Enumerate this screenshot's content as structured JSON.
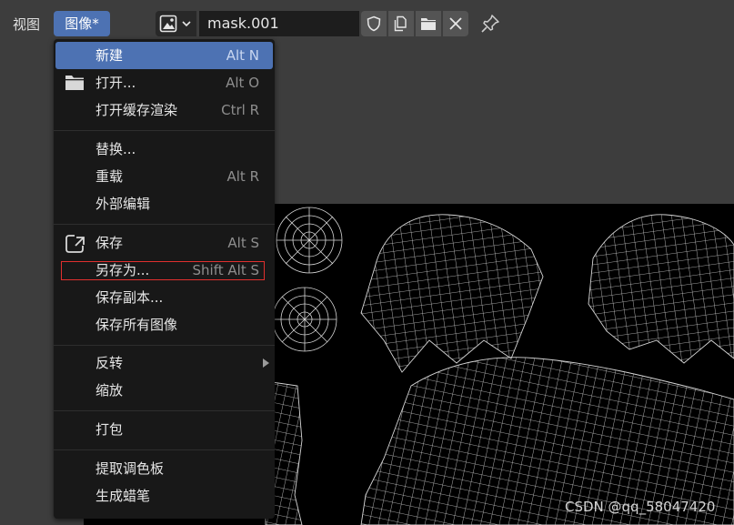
{
  "header": {
    "view_menu": "视图",
    "image_menu": "图像*",
    "image_name": "mask.001",
    "icons": [
      "image-type-icon",
      "shield-icon",
      "duplicate-icon",
      "folder-icon",
      "close-icon",
      "pin-icon"
    ]
  },
  "image_menu": {
    "items": [
      {
        "label": "新建",
        "shortcut": "Alt N",
        "icon": null,
        "active": true
      },
      {
        "label": "打开...",
        "shortcut": "Alt O",
        "icon": "folder-icon"
      },
      {
        "label": "打开缓存渲染",
        "shortcut": "Ctrl R"
      },
      {
        "label": "替换...",
        "shortcut": ""
      },
      {
        "label": "重载",
        "shortcut": "Alt R"
      },
      {
        "label": "外部编辑",
        "shortcut": ""
      },
      {
        "label": "保存",
        "shortcut": "Alt S",
        "icon": "save-icon"
      },
      {
        "label": "另存为...",
        "shortcut": "Shift Alt S",
        "highlighted": true
      },
      {
        "label": "保存副本...",
        "shortcut": ""
      },
      {
        "label": "保存所有图像",
        "shortcut": ""
      },
      {
        "label": "反转",
        "shortcut": "",
        "submenu": true
      },
      {
        "label": "缩放",
        "shortcut": ""
      },
      {
        "label": "打包",
        "shortcut": ""
      },
      {
        "label": "提取调色板",
        "shortcut": ""
      },
      {
        "label": "生成蜡笔",
        "shortcut": ""
      }
    ]
  },
  "watermark": "CSDN @qq_58047420",
  "colors": {
    "accent": "#4d72b3",
    "highlight_box": "#e0302e",
    "menu_bg": "#181818",
    "header_bg": "#3d3d3d"
  }
}
